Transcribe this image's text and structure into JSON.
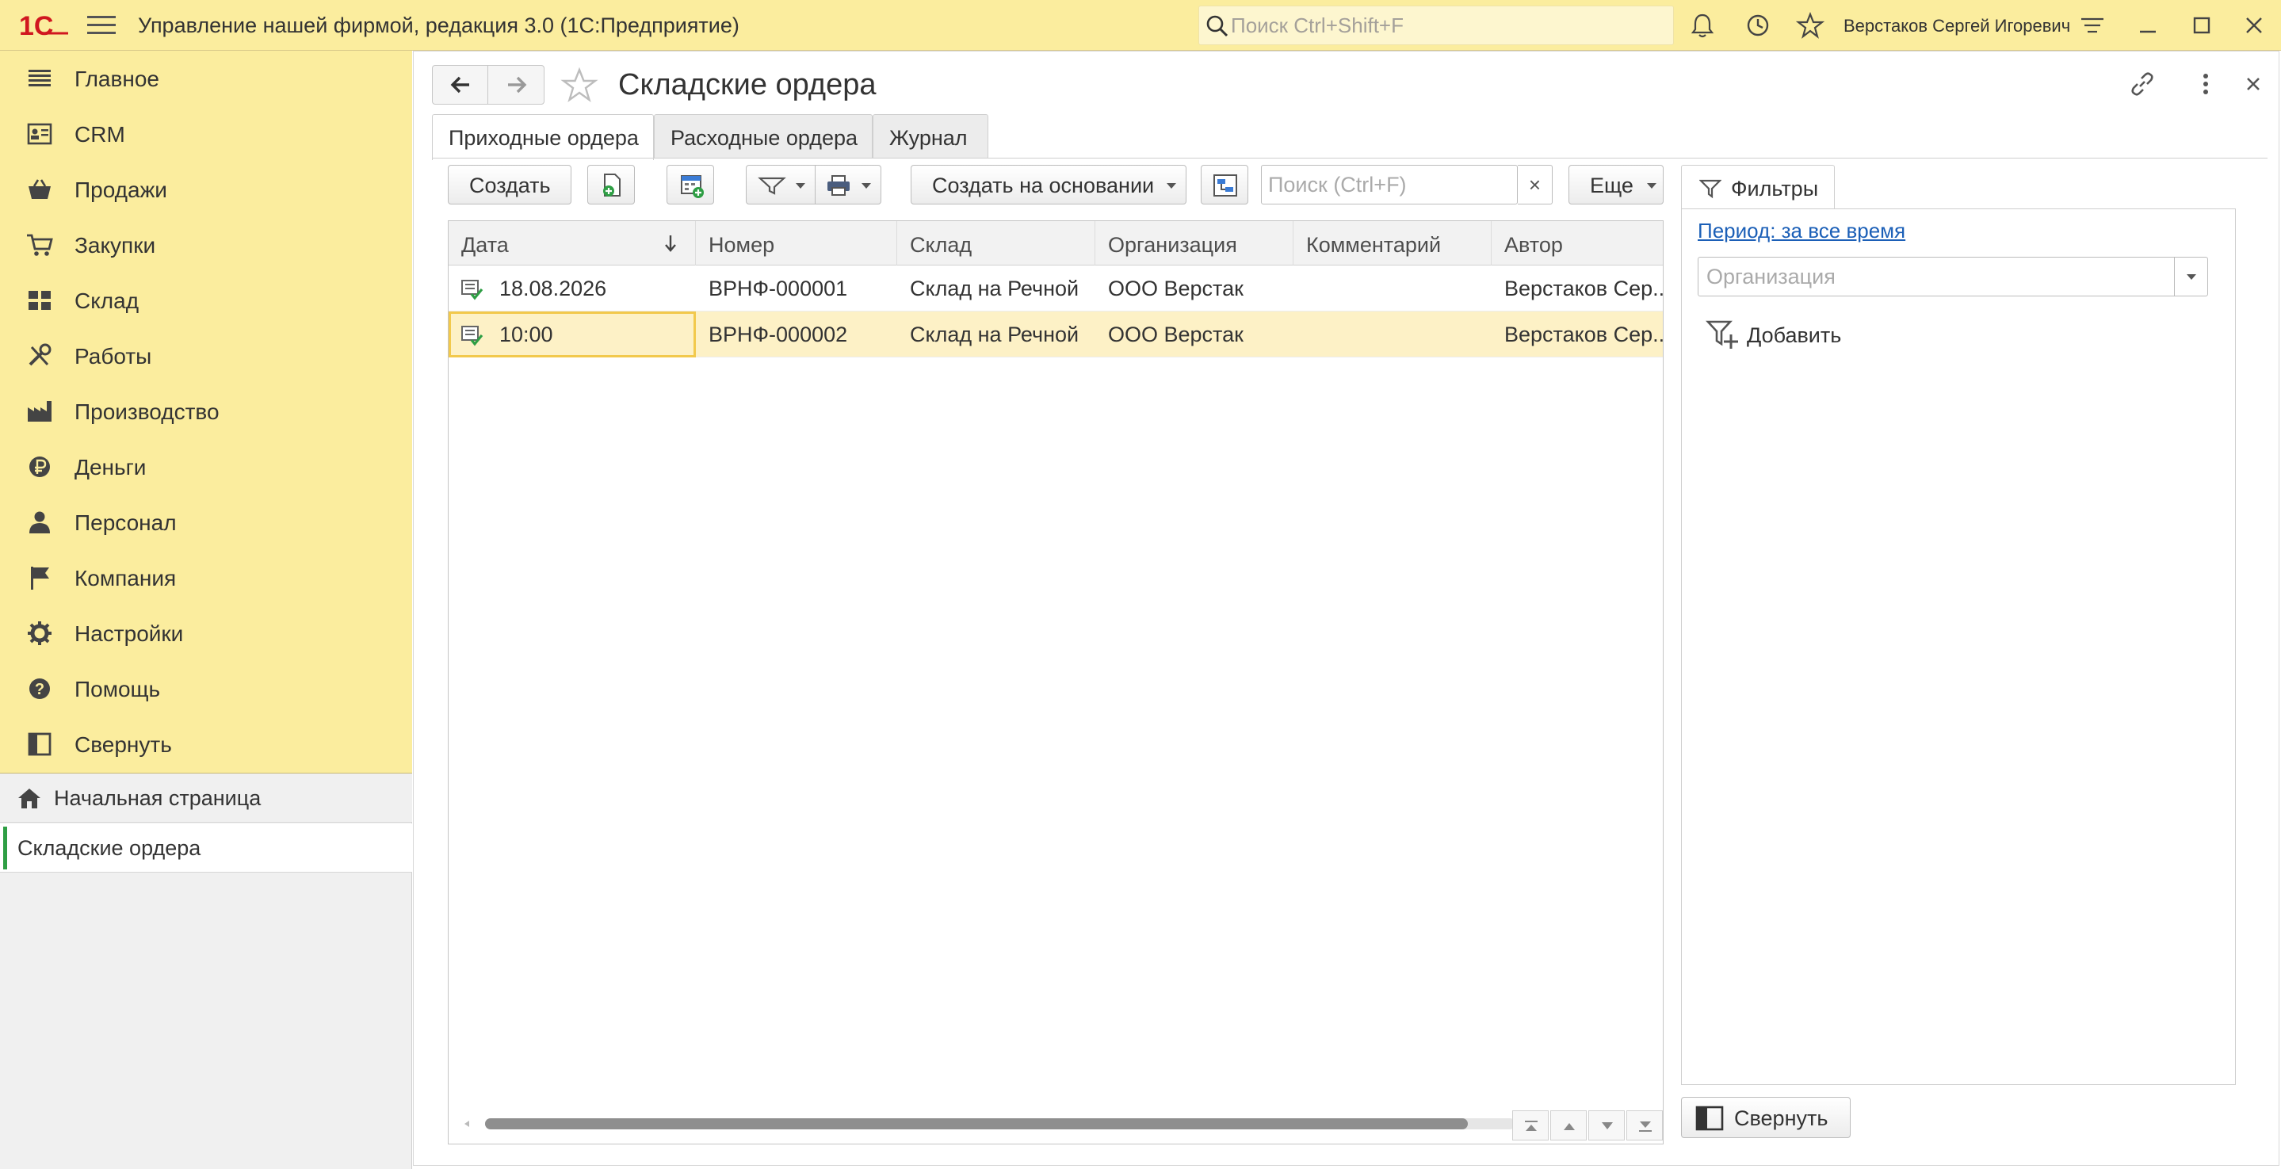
{
  "titlebar": {
    "app_title": "Управление нашей фирмой, редакция 3.0  (1С:Предприятие)",
    "search_placeholder": "Поиск Ctrl+Shift+F",
    "user_name": "Верстаков Сергей Игоревич",
    "icons": [
      "logo-1c-icon",
      "menu-icon",
      "search-icon",
      "bell-icon",
      "history-icon",
      "star-icon",
      "settings-lines-icon",
      "minimize-icon",
      "maximize-icon",
      "close-icon"
    ]
  },
  "sidebar": {
    "sections": [
      {
        "label": "Главное",
        "icon": "list-icon"
      },
      {
        "label": "CRM",
        "icon": "contact-card-icon"
      },
      {
        "label": "Продажи",
        "icon": "basket-icon"
      },
      {
        "label": "Закупки",
        "icon": "cart-icon"
      },
      {
        "label": "Склад",
        "icon": "warehouse-icon"
      },
      {
        "label": "Работы",
        "icon": "tools-icon"
      },
      {
        "label": "Производство",
        "icon": "factory-icon"
      },
      {
        "label": "Деньги",
        "icon": "ruble-icon"
      },
      {
        "label": "Персонал",
        "icon": "person-icon"
      },
      {
        "label": "Компания",
        "icon": "flag-icon"
      },
      {
        "label": "Настройки",
        "icon": "gear-icon"
      },
      {
        "label": "Помощь",
        "icon": "help-icon"
      },
      {
        "label": "Свернуть",
        "icon": "collapse-panel-icon"
      }
    ],
    "home": "Начальная страница",
    "open_windows": [
      "Складские ордера"
    ]
  },
  "form": {
    "title": "Складские ордера",
    "tabs": [
      "Приходные ордера",
      "Расходные ордера",
      "Журнал"
    ],
    "toolbar": {
      "create": "Создать",
      "create_based": "Создать на основании",
      "search_placeholder": "Поиск (Ctrl+F)",
      "clear": "×",
      "more": "Еще"
    },
    "table": {
      "columns": [
        "Дата",
        "Номер",
        "Склад",
        "Организация",
        "Комментарий",
        "Автор"
      ],
      "rows": [
        {
          "date": "18.08.2026",
          "number": "ВРНФ-000001",
          "warehouse": "Склад на Речной",
          "org": "ООО Верстак",
          "comment": "",
          "author": "Верстаков Сер..."
        },
        {
          "date": "10:00",
          "number": "ВРНФ-000002",
          "warehouse": "Склад на Речной",
          "org": "ООО Верстак",
          "comment": "",
          "author": "Верстаков Сер..."
        }
      ]
    },
    "filters": {
      "tab_label": "Фильтры",
      "period": "Период: за все время",
      "org_placeholder": "Организация",
      "add": "Добавить",
      "collapse": "Свернуть"
    }
  },
  "colors": {
    "accent_yellow": "#fbed9e",
    "selected_row": "#fdf1c6",
    "focus_border": "#f2c94c",
    "logo_red": "#d0171f",
    "link_blue": "#1b5fb7",
    "open_marker": "#2e9e44"
  }
}
